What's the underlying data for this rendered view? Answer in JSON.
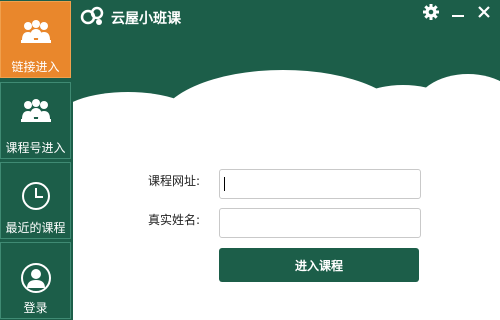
{
  "app": {
    "title": "云屋小班课"
  },
  "sidebar": {
    "items": [
      {
        "label": "链接进入",
        "icon": "group-icon",
        "active": true
      },
      {
        "label": "课程号进入",
        "icon": "group-icon",
        "active": false
      },
      {
        "label": "最近的课程",
        "icon": "clock-icon",
        "active": false
      },
      {
        "label": "登录",
        "icon": "user-icon",
        "active": false
      }
    ]
  },
  "window_controls": {
    "icons": [
      "gear-icon",
      "minimize-icon",
      "close-icon"
    ]
  },
  "form": {
    "course_url_label": "课程网址:",
    "course_url_value": "",
    "real_name_label": "真实姓名:",
    "real_name_value": "",
    "submit_label": "进入课程"
  },
  "colors": {
    "primary_green": "#1c5e49",
    "active_orange": "#e9872c",
    "content_bg": "#ffffff"
  }
}
